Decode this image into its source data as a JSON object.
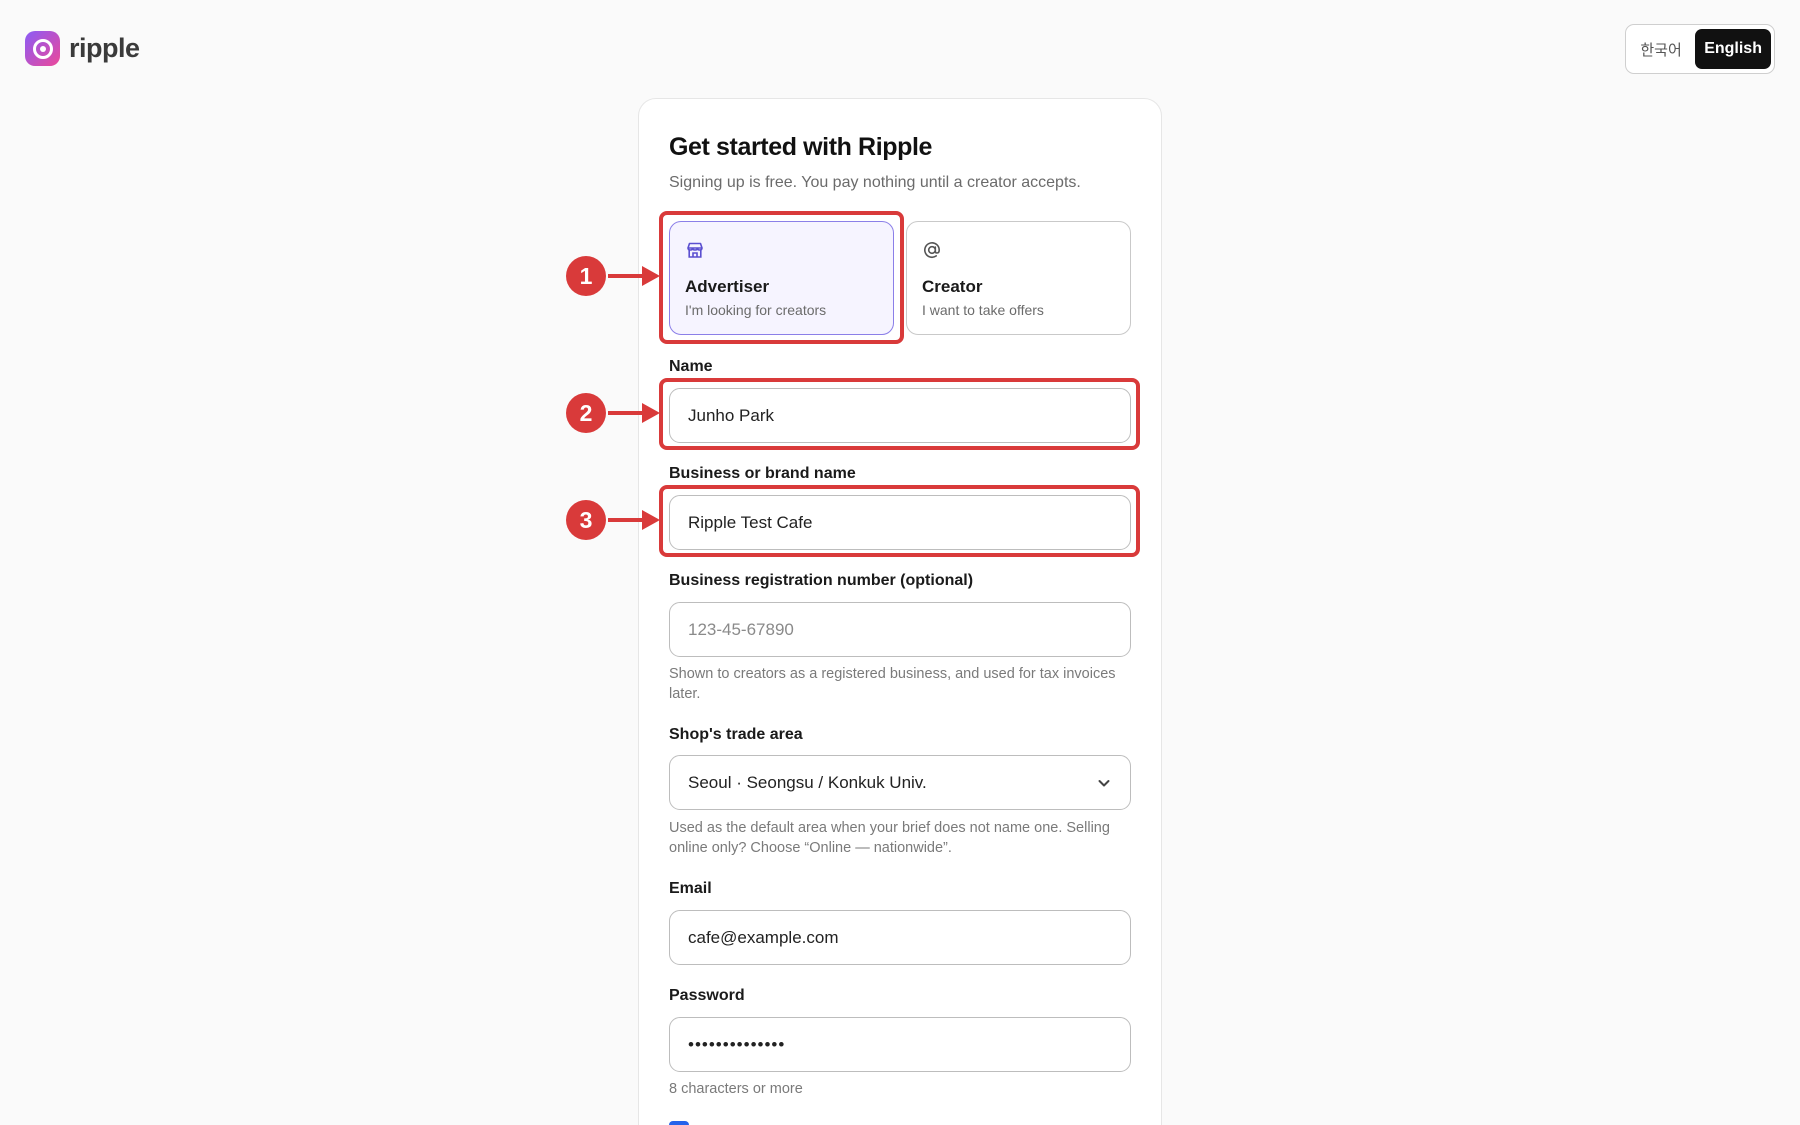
{
  "header": {
    "logo_text": "ripple",
    "lang_ko": "한국어",
    "lang_en": "English"
  },
  "form": {
    "title": "Get started with Ripple",
    "subtitle": "Signing up is free. You pay nothing until a creator accepts.",
    "roles": [
      {
        "title": "Advertiser",
        "desc": "I'm looking for creators",
        "icon": "store-icon",
        "selected": true
      },
      {
        "title": "Creator",
        "desc": "I want to take offers",
        "icon": "at-sign-icon",
        "selected": false
      }
    ],
    "name": {
      "label": "Name",
      "value": "Junho Park"
    },
    "business": {
      "label": "Business or brand name",
      "value": "Ripple Test Cafe"
    },
    "registration": {
      "label": "Business registration number (optional)",
      "placeholder": "123-45-67890",
      "help": "Shown to creators as a registered business, and used for tax invoices later."
    },
    "trade_area": {
      "label": "Shop's trade area",
      "value": "Seoul · Seongsu / Konkuk Univ.",
      "help": "Used as the default area when your brief does not name one. Selling online only? Choose “Online — nationwide”."
    },
    "email": {
      "label": "Email",
      "value": "cafe@example.com"
    },
    "password": {
      "label": "Password",
      "value": "••••••••••••••",
      "help": "8 characters or more"
    }
  },
  "annotations": [
    "1",
    "2",
    "3"
  ],
  "colors": {
    "accent": "#8b7fe8",
    "annotation": "#d93a3a",
    "dark": "#111111"
  }
}
